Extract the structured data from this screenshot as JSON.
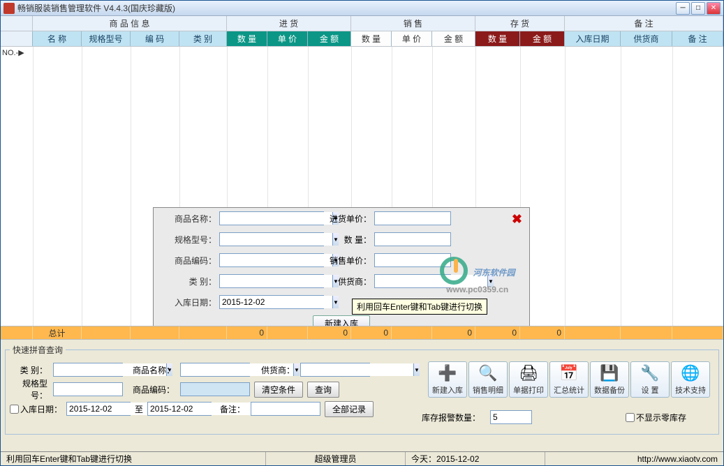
{
  "window": {
    "title": "畅销服装销售管理软件 V4.4.3(国庆珍藏版)"
  },
  "header_groups": {
    "blank": "",
    "product_info": "商 品 信 息",
    "purchase": "进 货",
    "sales": "销 售",
    "stock": "存 货",
    "remark": "备 注"
  },
  "columns": {
    "name": "名 称",
    "spec": "规格型号",
    "code": "编 码",
    "category": "类 别",
    "in_qty": "数 量",
    "in_price": "单 价",
    "in_amt": "金 额",
    "sale_qty": "数 量",
    "sale_price": "单 价",
    "sale_amt": "金 额",
    "stock_qty": "数 量",
    "stock_amt": "金 额",
    "in_date": "入库日期",
    "supplier": "供货商",
    "remark": "备 注"
  },
  "row_marker": "NO.-▶",
  "totals": {
    "label": "总计",
    "in_qty": "0",
    "in_amt": "0",
    "sale_qty": "0",
    "sale_amt": "0",
    "stock_qty": "0",
    "stock_amt": "0"
  },
  "dialog": {
    "product_name": "商品名称：",
    "spec": "规格型号：",
    "code": "商品编码：",
    "category": "类 别：",
    "in_date": "入库日期：",
    "in_price": "进货单价：",
    "qty": "数 量：",
    "sale_price": "销售单价：",
    "supplier": "供货商：",
    "date_value": "2015-12-02",
    "new_in": "新建入库",
    "tooltip": "利用回车Enter键和Tab键进行切换"
  },
  "watermark": {
    "text": "河东软件园",
    "url": "www.pc0359.cn"
  },
  "search": {
    "title": "快速拼音查询",
    "category": "类 别：",
    "product_name": "商品名称：",
    "supplier": "供货商：",
    "spec": "规格型号：",
    "code": "商品编码：",
    "clear": "清空条件",
    "query": "查询",
    "in_date_chk": "入库日期：",
    "date_from": "2015-12-02",
    "to": "至",
    "date_to": "2015-12-02",
    "remark": "备注：",
    "all_records": "全部记录"
  },
  "toolbar": {
    "new_in": "新建入库",
    "sales_detail": "销售明细",
    "print": "单据打印",
    "summary": "汇总统计",
    "backup": "数据备份",
    "settings": "设 置",
    "support": "技术支持"
  },
  "stock_alert": {
    "label": "库存报警数量：",
    "value": "5",
    "hide_zero": "不显示零库存"
  },
  "statusbar": {
    "hint": "利用回车Enter键和Tab键进行切换",
    "user": "超级管理员",
    "today_label": "今天：",
    "today": "2015-12-02",
    "url": "http://www.xiaotv.com"
  }
}
